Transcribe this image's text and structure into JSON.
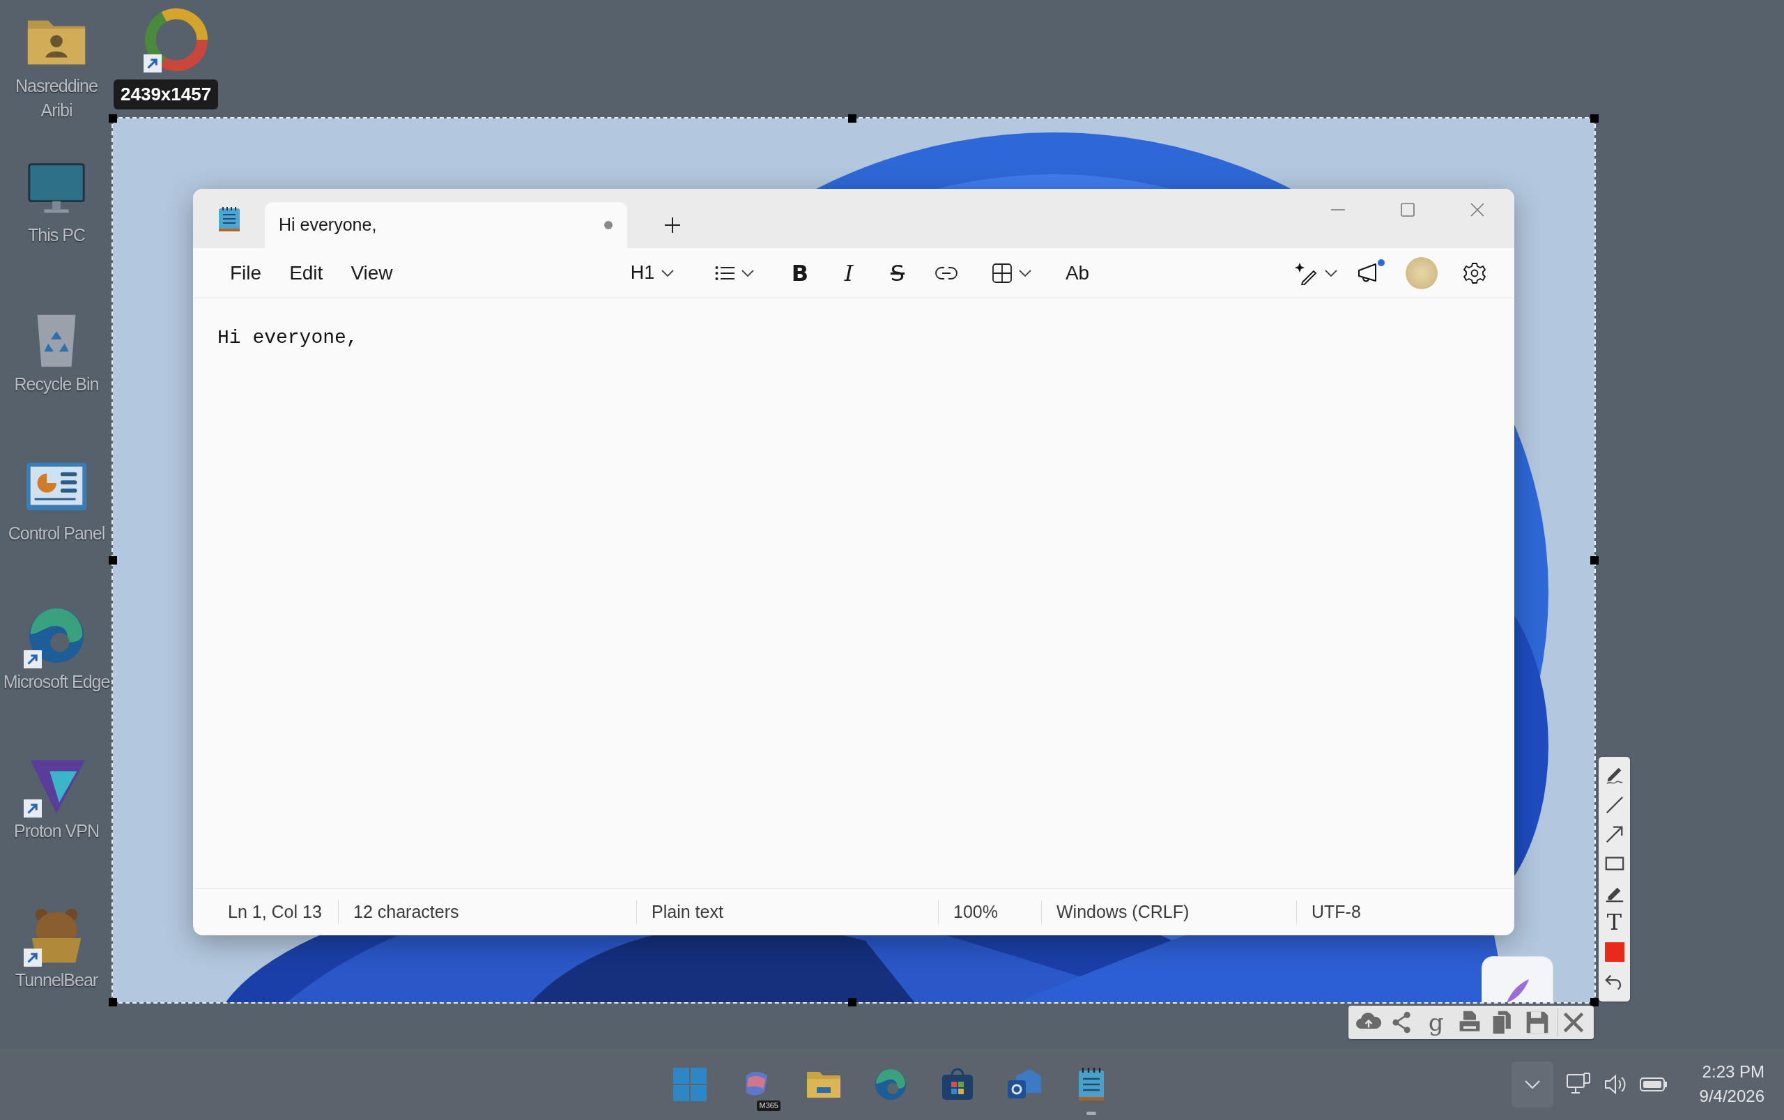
{
  "desktop": {
    "icons": [
      {
        "kind": "user-folder",
        "label": "Nasreddine Aribi",
        "shortcut": false
      },
      {
        "kind": "monitor",
        "label": "This PC",
        "shortcut": false
      },
      {
        "kind": "recycle-bin",
        "label": "Recycle Bin",
        "shortcut": false
      },
      {
        "kind": "control-panel",
        "label": "Control Panel",
        "shortcut": false
      },
      {
        "kind": "edge",
        "label": "Microsoft Edge",
        "shortcut": true
      },
      {
        "kind": "vpn",
        "label": "Proton VPN",
        "shortcut": true
      },
      {
        "kind": "bear",
        "label": "TunnelBear",
        "shortcut": true
      }
    ],
    "hidden_label_icon": {
      "kind": "ring",
      "shortcut": true
    }
  },
  "capture": {
    "size_label": "2439x1457"
  },
  "notepad": {
    "tabs": [
      {
        "title": "Hi everyone,",
        "unsaved": true,
        "selected": true
      }
    ],
    "menu": [
      "File",
      "Edit",
      "View"
    ],
    "heading": "H1",
    "format_buttons": [
      {
        "kind": "bold",
        "glyph": "B"
      },
      {
        "kind": "italic",
        "glyph": "I"
      },
      {
        "kind": "strike",
        "glyph": "S"
      }
    ],
    "spellcheck_glyph": "Ab",
    "whats_new_unread": true,
    "text": "Hi everyone,",
    "status_bar": [
      "Ln 1, Col 13",
      "12 characters",
      "Plain text",
      "100%",
      "Windows (CRLF)",
      "UTF-8"
    ]
  },
  "capture_palette": {
    "tools": [
      {
        "kind": "freehand"
      },
      {
        "kind": "line"
      },
      {
        "kind": "arrow"
      },
      {
        "kind": "rectangle"
      },
      {
        "kind": "marker"
      },
      {
        "kind": "text",
        "glyph": "T"
      },
      {
        "kind": "color",
        "color": "#e8291c"
      },
      {
        "kind": "undo"
      }
    ]
  },
  "capture_actions": [
    {
      "kind": "upload"
    },
    {
      "kind": "share"
    },
    {
      "kind": "search",
      "glyph": "g"
    },
    {
      "kind": "print"
    },
    {
      "kind": "copy"
    },
    {
      "kind": "save"
    },
    {
      "kind": "close"
    }
  ],
  "taskbar": {
    "apps": [
      {
        "kind": "start",
        "running": false
      },
      {
        "kind": "m365",
        "badge": "M365",
        "running": false
      },
      {
        "kind": "files",
        "running": false
      },
      {
        "kind": "edge",
        "running": false
      },
      {
        "kind": "store",
        "running": false
      },
      {
        "kind": "outlook",
        "running": false
      },
      {
        "kind": "notepad",
        "running": true
      }
    ],
    "time": "2:23 PM",
    "date": "9/4/2026"
  }
}
